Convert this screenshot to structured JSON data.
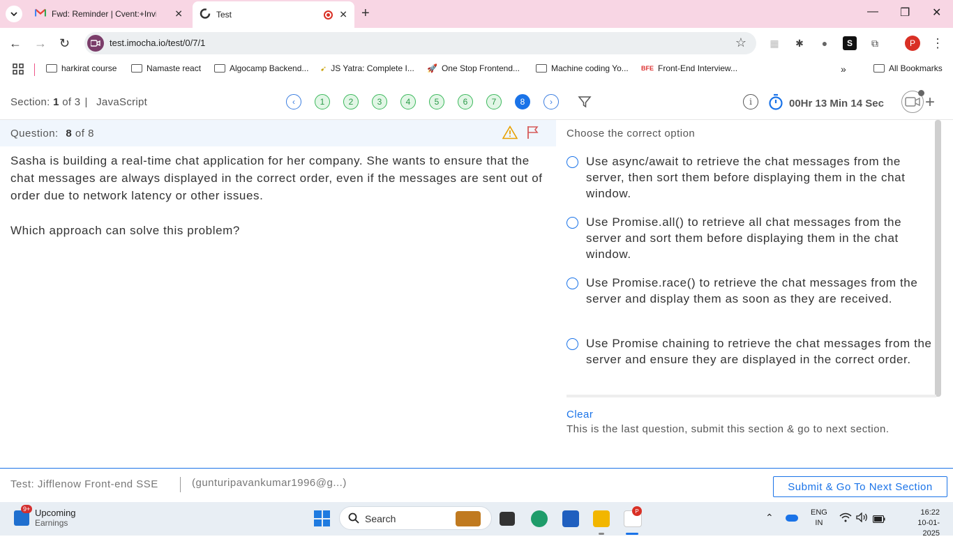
{
  "browser": {
    "tabs": [
      {
        "title": "Fwd: Reminder | Cvent:+Invitati",
        "icon": "gmail-icon"
      },
      {
        "title": "Test",
        "icon": "imocha-icon"
      }
    ],
    "url": "test.imocha.io/test/0/7/1",
    "profile_initial": "P",
    "bookmarks": [
      "harkirat course",
      "Namaste react",
      "Algocamp Backend...",
      "JS Yatra: Complete I...",
      "One Stop Frontend...",
      "Machine coding Yo...",
      "Front-End Interview..."
    ],
    "bookmark_badge": "BFE",
    "all_bookmarks": "All Bookmarks"
  },
  "section": {
    "prefix": "Section:",
    "current": "1",
    "of": "of",
    "total": "3",
    "divider": "|",
    "name": "JavaScript"
  },
  "question_nav": {
    "numbers": [
      "1",
      "2",
      "3",
      "4",
      "5",
      "6",
      "7",
      "8"
    ],
    "active": "8"
  },
  "timer": {
    "text": "00Hr 13 Min 14 Sec"
  },
  "question": {
    "label": "Question:",
    "number": "8",
    "of_total": "of 8",
    "text_para1": "Sasha is building a real-time chat application for her company. She wants to ensure that the chat messages are always displayed in the correct order, even if the messages are sent out of order due to network latency or other issues.",
    "text_para2": "Which approach can solve this problem?"
  },
  "answers": {
    "heading": "Choose the correct option",
    "options": [
      "Use async/await to retrieve the chat messages from the server, then sort them before displaying them in the chat window.",
      "Use Promise.all() to retrieve all chat messages from the server and sort them before displaying them in the chat window.",
      "Use Promise.race() to retrieve the chat messages from the server and display them as soon as they are received.",
      "Use Promise chaining to retrieve the chat messages from the server and ensure they are displayed in the correct order."
    ],
    "clear": "Clear",
    "last_message": "This is the last question, submit this section & go to next section."
  },
  "footer": {
    "test_name": "Test: Jifflenow Front-end SSE",
    "email": "(gunturipavankumar1996@g...)",
    "submit": "Submit & Go To Next Section"
  },
  "taskbar": {
    "widget_badge": "9+",
    "widget_title": "Upcoming",
    "widget_sub": "Earnings",
    "search": "Search",
    "lang1": "ENG",
    "lang2": "IN",
    "time": "16:22",
    "date": "10-01-2025"
  },
  "colors": {
    "accent": "#1a73e8",
    "answered": "#3bb85b",
    "tabbar": "#f8d6e4"
  }
}
